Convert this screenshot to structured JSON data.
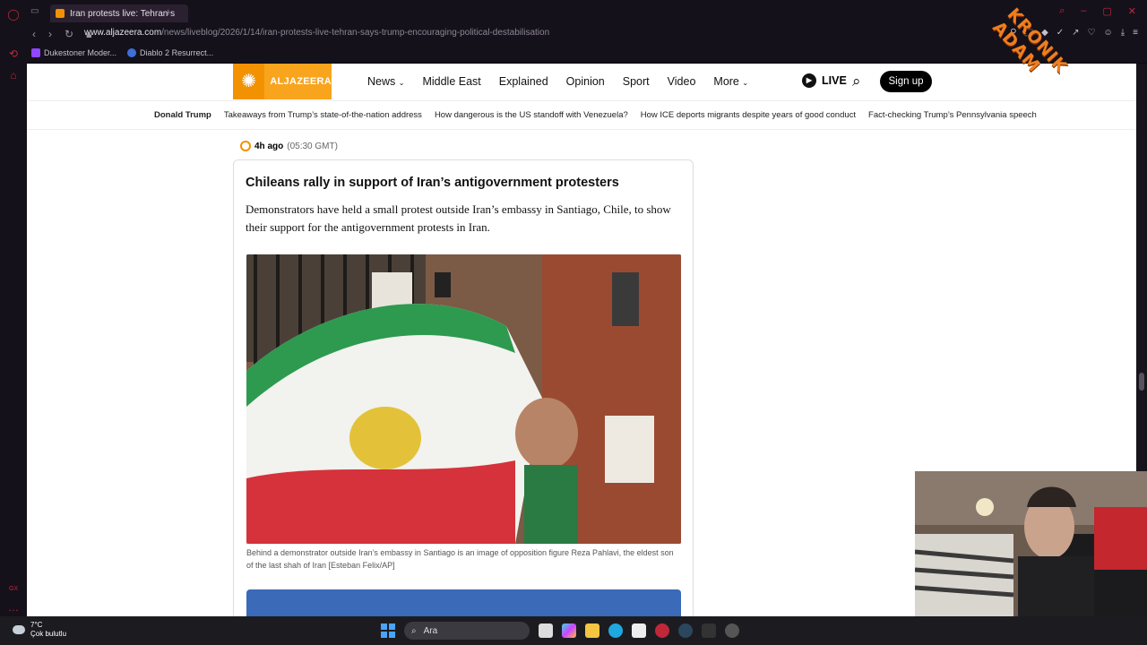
{
  "browser": {
    "tab_title": "Iran protests live: Tehran s",
    "url_domain": "www.aljazeera.com",
    "url_path": "/news/liveblog/2026/1/14/iran-protests-live-tehran-says-trump-encouraging-political-destabilisation",
    "bookmarks": [
      "Dukestoner Moder...",
      "Diablo 2 Resurrect..."
    ],
    "accent": "#c0283a"
  },
  "site": {
    "logo_text": "ALJAZEERA",
    "nav": [
      "News",
      "Middle East",
      "Explained",
      "Opinion",
      "Sport",
      "Video",
      "More"
    ],
    "live": "LIVE",
    "signup": "Sign up",
    "brand_color": "#f8a41d"
  },
  "subnav": {
    "highlight": "Donald Trump",
    "links": [
      "Takeaways from Trump’s state-of-the-nation address",
      "How dangerous is the US standoff with Venezuela?",
      "How ICE deports migrants despite years of good conduct",
      "Fact-checking Trump’s Pennsylvania speech"
    ]
  },
  "post": {
    "time_ago": "4h ago",
    "time_gmt": "(05:30 GMT)",
    "headline": "Chileans rally in support of Iran’s antigovernment protesters",
    "body": "Demonstrators have held a small protest outside Iran’s embassy in Santiago, Chile, to show their support for the antigovernment protests in Iran.",
    "caption": "Behind a demonstrator outside Iran’s embassy in Santiago is an image of opposition figure Reza Pahlavi, the eldest son of the last shah of Iran [Esteban Felix/AP]"
  },
  "overlay": {
    "watermark": "KRONIK ADAM"
  },
  "taskbar": {
    "temp": "7°C",
    "condition": "Çok bulutlu",
    "search": "Ara"
  }
}
